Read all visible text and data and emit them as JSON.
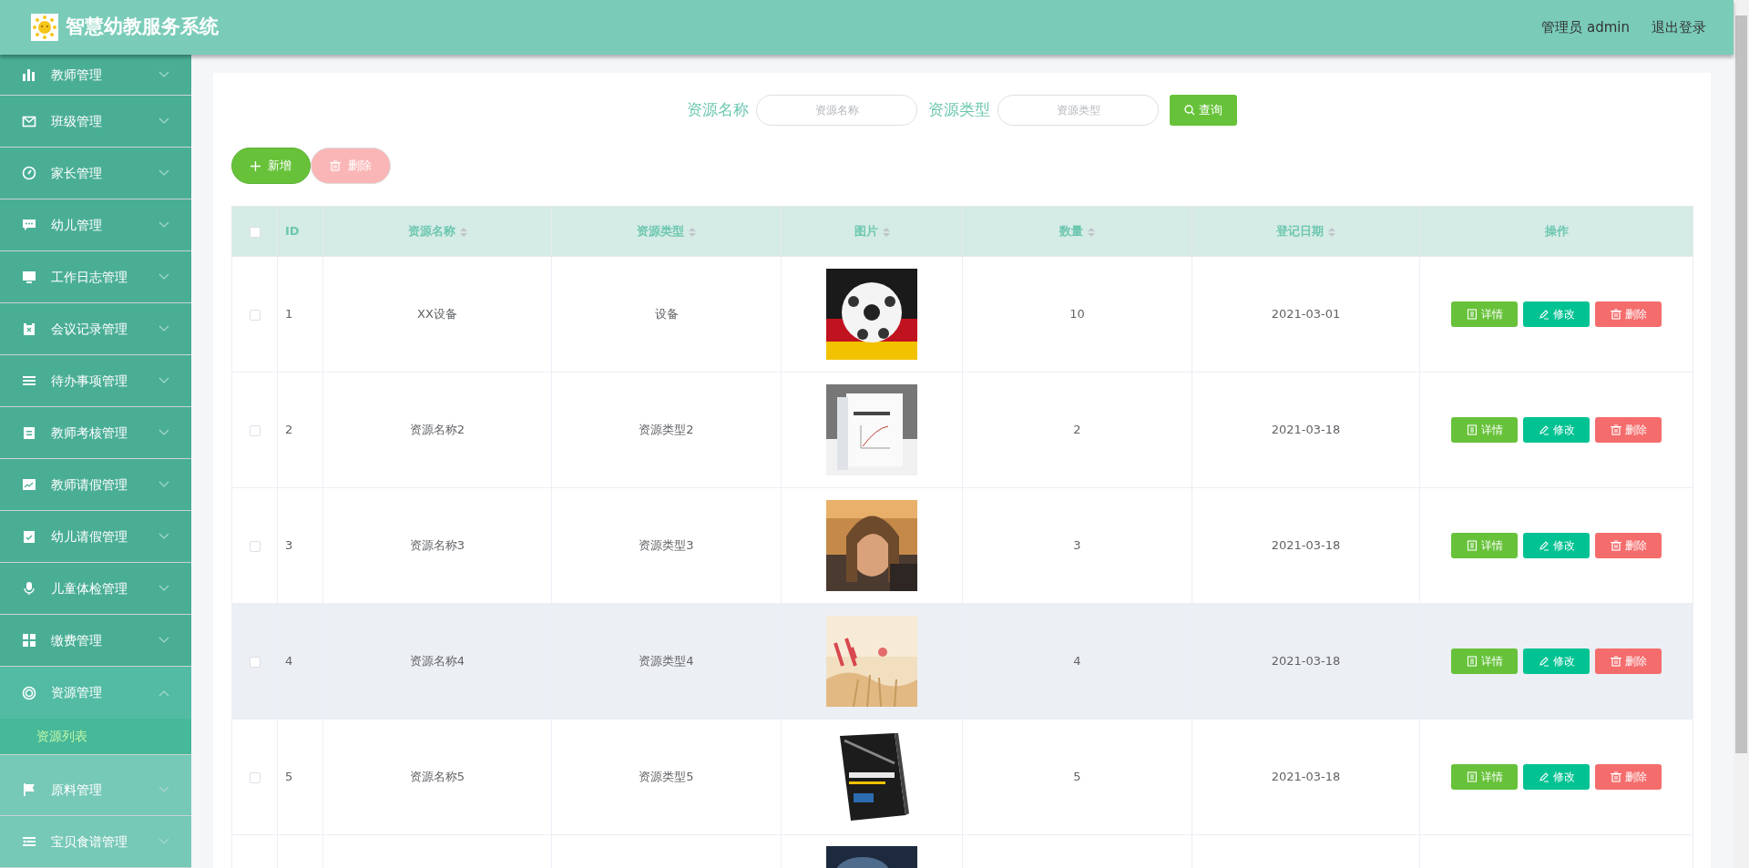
{
  "header": {
    "title": "智慧幼教服务系统",
    "user": "管理员 admin",
    "logout": "退出登录"
  },
  "sidebar": {
    "items": [
      {
        "label": "教师管理",
        "expanded": false
      },
      {
        "label": "班级管理",
        "expanded": false
      },
      {
        "label": "家长管理",
        "expanded": false
      },
      {
        "label": "幼儿管理",
        "expanded": false
      },
      {
        "label": "工作日志管理",
        "expanded": false
      },
      {
        "label": "会议记录管理",
        "expanded": false
      },
      {
        "label": "待办事项管理",
        "expanded": false
      },
      {
        "label": "教师考核管理",
        "expanded": false
      },
      {
        "label": "教师请假管理",
        "expanded": false
      },
      {
        "label": "幼儿请假管理",
        "expanded": false
      },
      {
        "label": "儿童体检管理",
        "expanded": false
      },
      {
        "label": "缴费管理",
        "expanded": false
      },
      {
        "label": "资源管理",
        "expanded": true,
        "children": [
          {
            "label": "资源列表",
            "selected": true
          }
        ]
      },
      {
        "label": "原料管理",
        "expanded": false
      },
      {
        "label": "宝贝食谱管理",
        "expanded": false
      }
    ]
  },
  "search": {
    "fields": [
      {
        "label": "资源名称",
        "placeholder": "资源名称"
      },
      {
        "label": "资源类型",
        "placeholder": "资源类型"
      }
    ],
    "button": "查询"
  },
  "toolbar": {
    "add": "新增",
    "delete": {
      "label": "删除",
      "disabled": true
    }
  },
  "table": {
    "columns": [
      "ID",
      "资源名称",
      "资源类型",
      "图片",
      "数量",
      "登记日期",
      "操作"
    ],
    "select_all_checked": false,
    "rows": [
      {
        "checked": false,
        "id": "1",
        "name": "XX设备",
        "type": "设备",
        "quantity": "10",
        "date": "2021-03-01",
        "highlighted": false,
        "actions": [
          "详情",
          "修改",
          "删除"
        ]
      },
      {
        "checked": false,
        "id": "2",
        "name": "资源名称2",
        "type": "资源类型2",
        "quantity": "2",
        "date": "2021-03-18",
        "highlighted": false,
        "actions": [
          "详情",
          "修改",
          "删除"
        ]
      },
      {
        "checked": false,
        "id": "3",
        "name": "资源名称3",
        "type": "资源类型3",
        "quantity": "3",
        "date": "2021-03-18",
        "highlighted": false,
        "actions": [
          "详情",
          "修改",
          "删除"
        ]
      },
      {
        "checked": false,
        "id": "4",
        "name": "资源名称4",
        "type": "资源类型4",
        "quantity": "4",
        "date": "2021-03-18",
        "highlighted": true,
        "actions": [
          "详情",
          "修改",
          "删除"
        ]
      },
      {
        "checked": false,
        "id": "5",
        "name": "资源名称5",
        "type": "资源类型5",
        "quantity": "5",
        "date": "2021-03-18",
        "highlighted": false,
        "actions": [
          "详情",
          "修改",
          "删除"
        ]
      }
    ]
  }
}
